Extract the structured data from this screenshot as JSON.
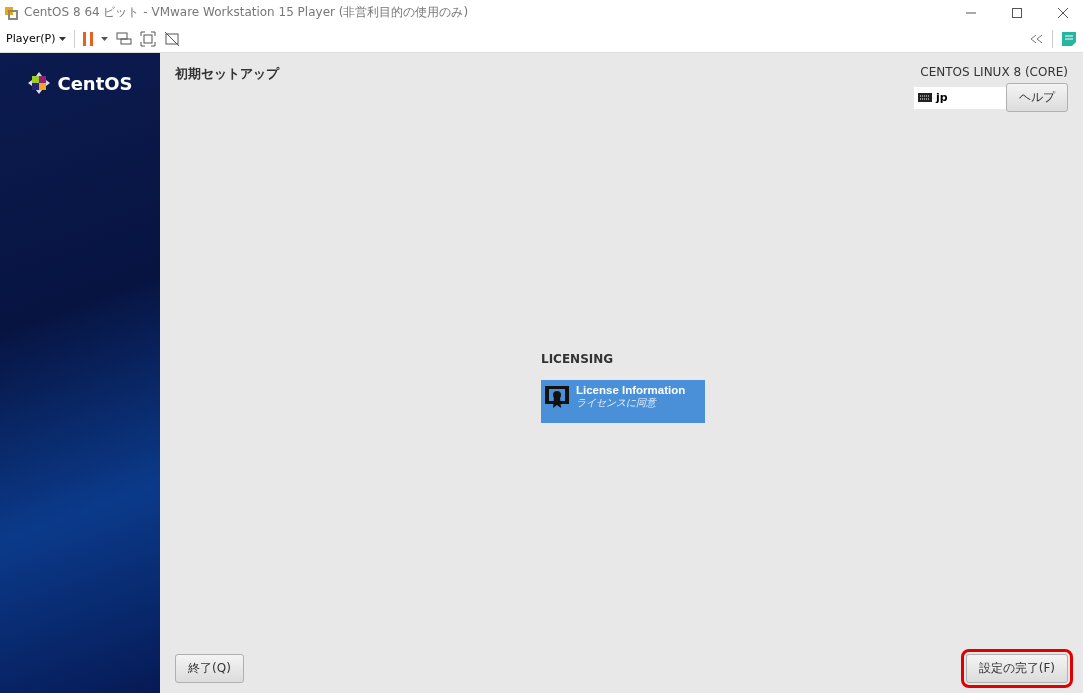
{
  "window": {
    "title": "CentOS 8 64 ビット - VMware Workstation 15 Player (非営利目的の使用のみ)"
  },
  "toolbar": {
    "player_menu": "Player(P)"
  },
  "sidebar": {
    "logo_text": "CentOS"
  },
  "header": {
    "title": "初期セットアップ",
    "product": "CENTOS LINUX 8 (CORE)",
    "keyboard_layout": "jp",
    "help_button": "ヘルプ"
  },
  "section": {
    "heading": "LICENSING",
    "spoke": {
      "title": "License Information",
      "status": "ライセンスに同意",
      "selected": true
    }
  },
  "footer": {
    "quit_button": "終了(Q)",
    "finish_button": {
      "label": "設定の完了(F)",
      "highlighted": true
    }
  }
}
